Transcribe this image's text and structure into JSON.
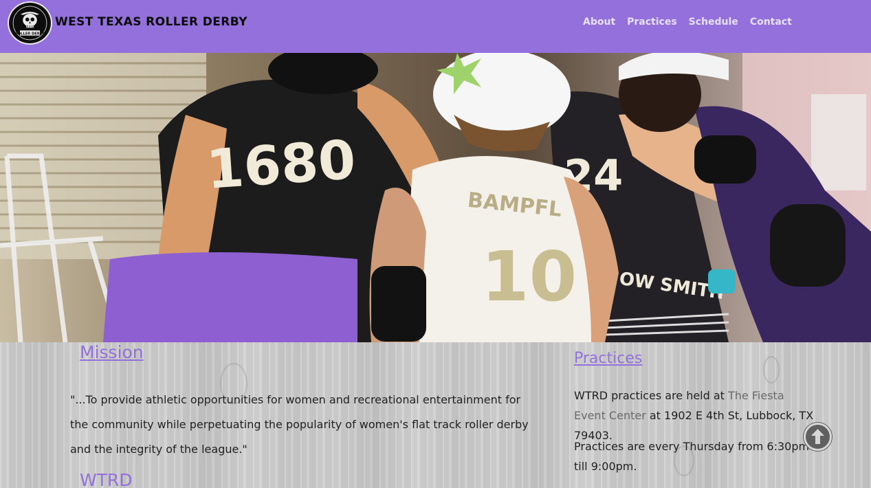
{
  "header": {
    "site_title": "West Texas Roller Derby",
    "background_color": "#9370db",
    "logo": {
      "icon": "skull-logo-icon",
      "ring_text_bottom": "ROLLER DERBY"
    }
  },
  "nav": {
    "items": [
      {
        "label": "About"
      },
      {
        "label": "Practices"
      },
      {
        "label": "Schedule"
      },
      {
        "label": "Contact"
      }
    ]
  },
  "hero": {
    "description_icon": "roller-derby-photo",
    "jersey_numbers": [
      "1680",
      "10",
      "24"
    ],
    "jersey_names": [
      "BAMPFL",
      "OW SMITH"
    ]
  },
  "mission": {
    "heading": "Mission",
    "text": "\"...To provide athletic opportunities for women and recreational entertainment for the community while perpetuating the popularity of women's flat track roller derby and the integrity of the league.\""
  },
  "wtrd": {
    "heading": "WTRD"
  },
  "practices": {
    "heading": "Practices",
    "p1_prefix": "WTRD practices are held at ",
    "p1_link": "The Fiesta Event Center",
    "p1_suffix": " at 1902 E 4th St, Lubbock, TX 79403.",
    "p2": "Practices are every Thursday from 6:30pm till 9:00pm."
  },
  "scroll_top": {
    "icon": "arrow-up-circle-icon"
  },
  "colors": {
    "accent": "#9370db",
    "text": "#222222",
    "link_muted": "#6a6a6a"
  }
}
